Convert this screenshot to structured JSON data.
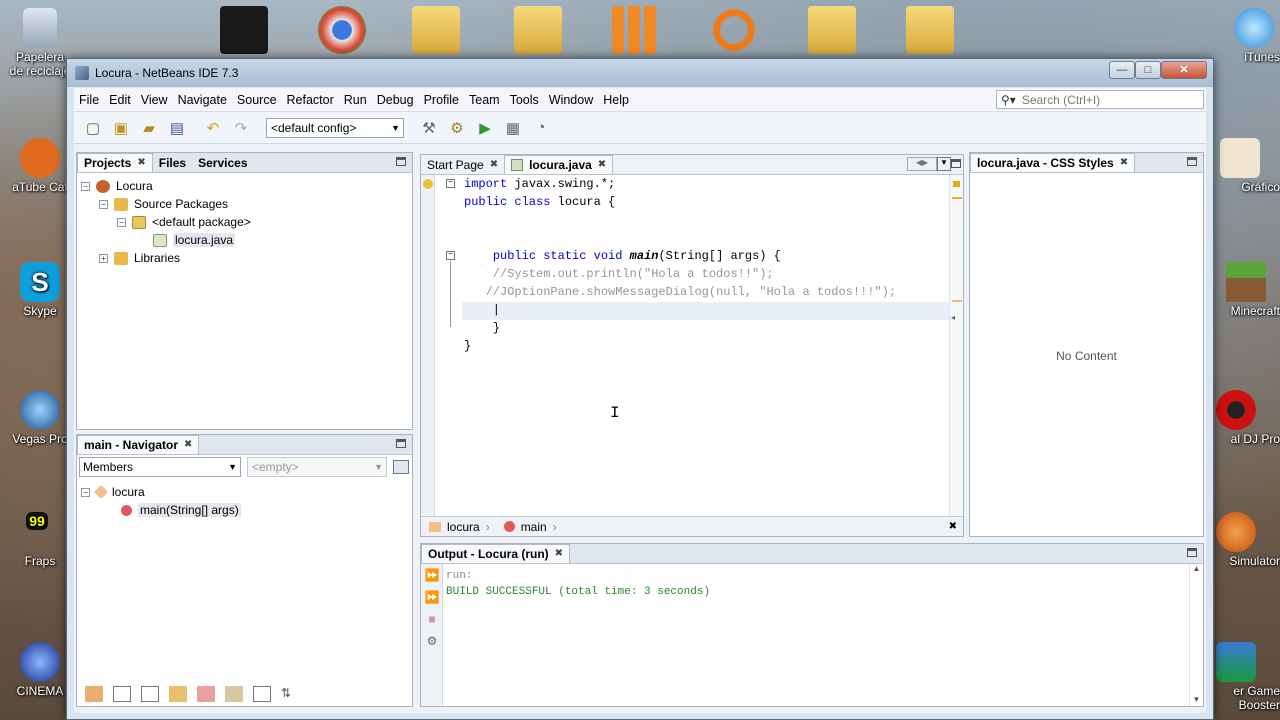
{
  "desktop": {
    "left_icons": [
      {
        "label": "Papelera de reciclaje"
      },
      {
        "label": "aTube Cat"
      },
      {
        "label": "Skype"
      },
      {
        "label": "Vegas Pro"
      },
      {
        "label": "Fraps"
      },
      {
        "label": "CINEMA"
      }
    ],
    "right_icons": [
      {
        "label": "iTunes"
      },
      {
        "label": "Gráfico"
      },
      {
        "label": "Minecraft"
      },
      {
        "label": "al DJ Pro"
      },
      {
        "label": "Simulator"
      },
      {
        "label": "er Game Booster"
      }
    ]
  },
  "window": {
    "title": "Locura - NetBeans IDE 7.3",
    "min": "—",
    "max": "□",
    "close": "✕"
  },
  "menu": [
    "File",
    "Edit",
    "View",
    "Navigate",
    "Source",
    "Refactor",
    "Run",
    "Debug",
    "Profile",
    "Team",
    "Tools",
    "Window",
    "Help"
  ],
  "search": {
    "placeholder": "Search (Ctrl+I)"
  },
  "toolbar": {
    "config": "<default config>"
  },
  "projects_panel": {
    "tabs": [
      "Projects",
      "Files",
      "Services"
    ],
    "tree": {
      "root": "Locura",
      "source_packages": "Source Packages",
      "default_package": "<default package>",
      "file": "locura.java",
      "libraries": "Libraries"
    }
  },
  "navigator": {
    "title": "main - Navigator",
    "filter": "Members",
    "empty": "<empty>",
    "class": "locura",
    "method": "main(String[] args)"
  },
  "editor": {
    "tabs": [
      "Start Page",
      "locura.java"
    ],
    "lines": [
      {
        "segs": [
          [
            "kw",
            "import"
          ],
          [
            "",
            " javax.swing.*;"
          ]
        ]
      },
      {
        "segs": [
          [
            "kw",
            "public class"
          ],
          [
            "",
            " locura {"
          ]
        ]
      },
      {
        "segs": []
      },
      {
        "segs": []
      },
      {
        "segs": [
          [
            "",
            "    "
          ],
          [
            "kw",
            "public static void"
          ],
          [
            "",
            " "
          ],
          [
            "b",
            "main"
          ],
          [
            "",
            "(String[] args) {"
          ]
        ]
      },
      {
        "segs": [
          [
            "cm",
            "    //System.out.println(\"Hola a todos!!\");"
          ]
        ]
      },
      {
        "segs": [
          [
            "cm",
            "   //JOptionPane.showMessageDialog(null, \"Hola a todos!!!\");"
          ]
        ]
      },
      {
        "segs": [
          [
            "",
            "    |"
          ]
        ]
      },
      {
        "segs": [
          [
            "",
            "    }"
          ]
        ]
      },
      {
        "segs": [
          [
            "",
            "}"
          ]
        ]
      }
    ],
    "crumbs": [
      "locura",
      "main"
    ]
  },
  "css_panel": {
    "title": "locura.java - CSS Styles",
    "empty": "No Content"
  },
  "output": {
    "title": "Output - Locura (run)",
    "lines": [
      {
        "text": "run:",
        "color": "#888888"
      },
      {
        "text": "BUILD SUCCESSFUL (total time: 3 seconds)",
        "color": "#2a8a2a"
      }
    ]
  }
}
